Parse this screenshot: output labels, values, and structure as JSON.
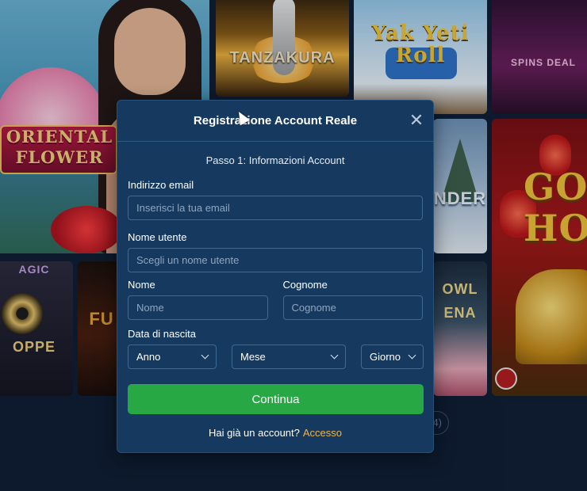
{
  "background": {
    "games": {
      "oriental_flower": "ORIENTAL FLOWER",
      "tanzakura": "TANZAKURA",
      "yak_yeti_roll": "Yak Yeti Roll",
      "spins_deal": "SPINS DEAL",
      "magic_shoppe_top": "AGIC",
      "magic_shoppe_bottom": "OPPE",
      "fu": "FU",
      "thunder": "NDER",
      "bowl": "OWL ENA",
      "gold": "GO HO"
    },
    "pager_text": "4)"
  },
  "modal": {
    "title": "Registrazione Account Reale",
    "close_symbol": "✕",
    "step": "Passo 1: Informazioni Account",
    "email": {
      "label": "Indirizzo email",
      "placeholder": "Inserisci la tua email"
    },
    "username": {
      "label": "Nome utente",
      "placeholder": "Scegli un nome utente"
    },
    "first_name": {
      "label": "Nome",
      "placeholder": "Nome"
    },
    "last_name": {
      "label": "Cognome",
      "placeholder": "Cognome"
    },
    "dob": {
      "label": "Data di nascita",
      "year": "Anno",
      "month": "Mese",
      "day": "Giorno"
    },
    "continue_label": "Continua",
    "login_prompt": "Hai già un account?",
    "login_link": "Accesso"
  },
  "colors": {
    "modal_bg": "#163a5f",
    "accent_green": "#27a844",
    "link_orange": "#f2b441"
  }
}
